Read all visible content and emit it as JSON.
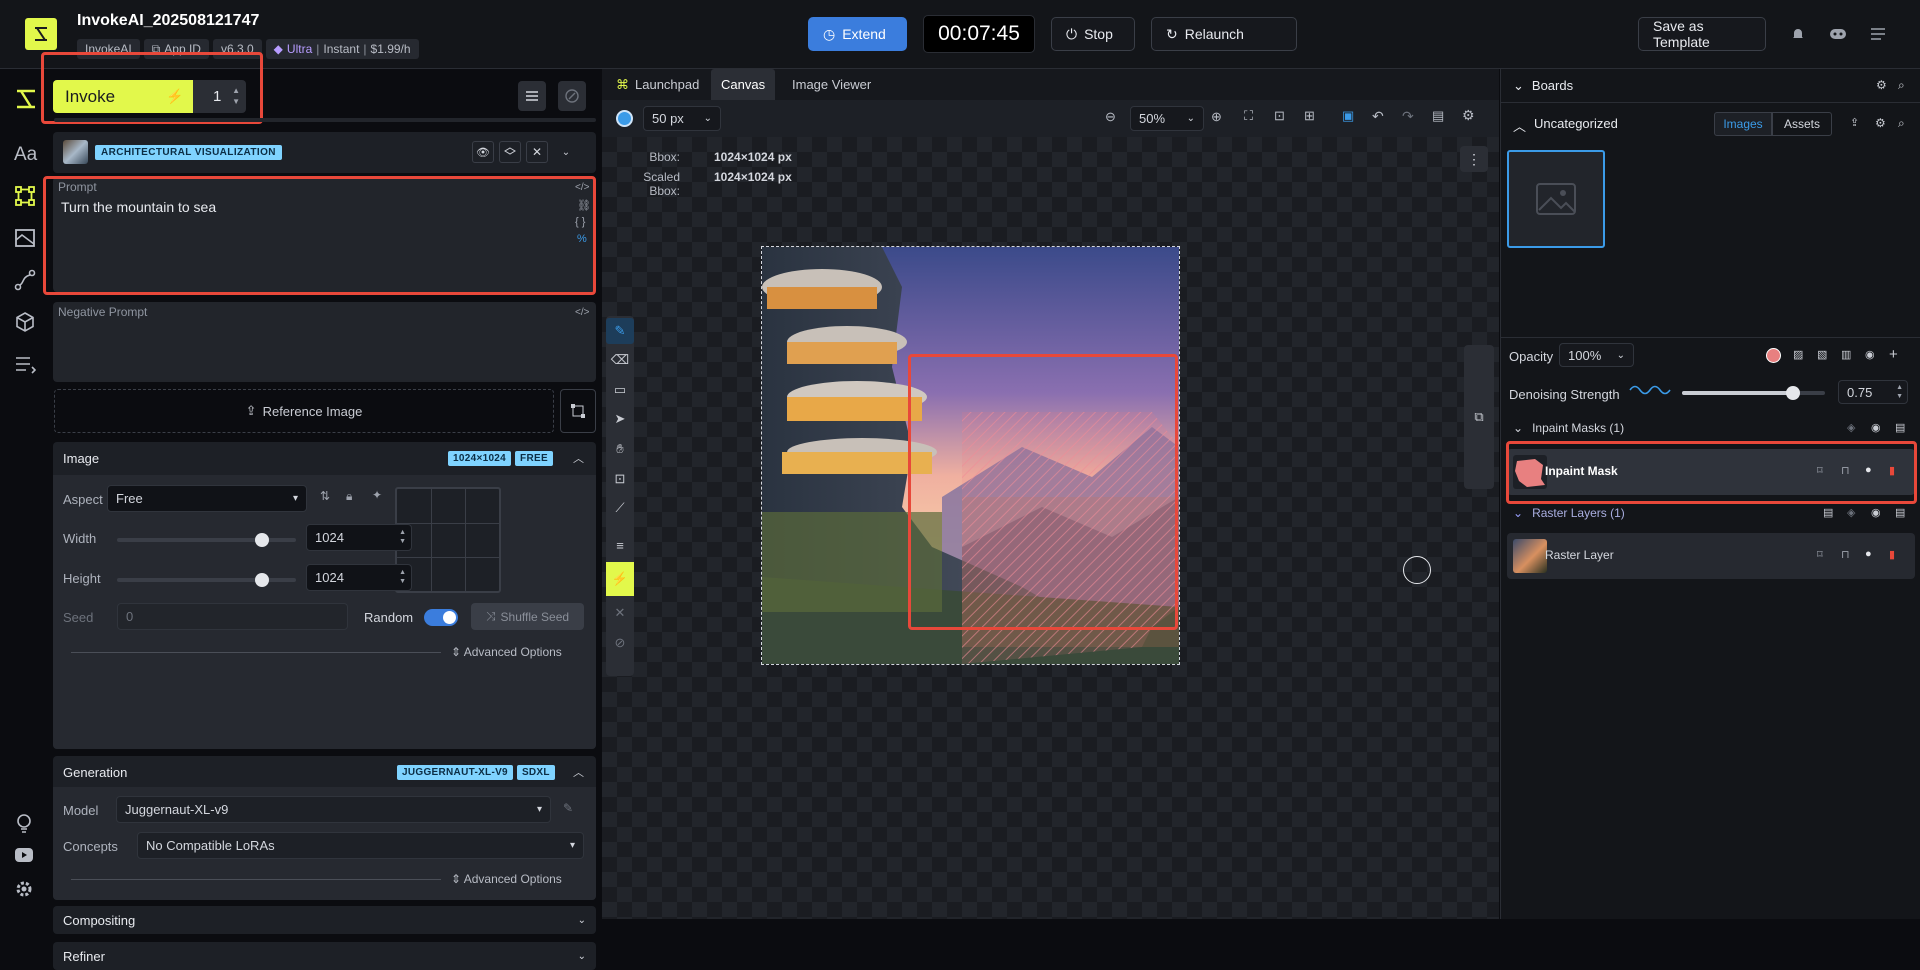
{
  "header": {
    "title": "InvokeAI_202508121747",
    "tags": {
      "brand": "InvokeAI",
      "app_id": "App ID",
      "version": "v6.3.0",
      "tier": "Ultra",
      "mode": "Instant",
      "price": "$1.99/h"
    },
    "extend": "Extend",
    "timer": "00:07:45",
    "stop": "Stop",
    "relaunch": "Relaunch",
    "save_template": "Save as Template"
  },
  "invoke": {
    "label": "Invoke",
    "count": "1"
  },
  "style_preset": {
    "label": "ARCHITECTURAL VISUALIZATION"
  },
  "prompt": {
    "label": "Prompt",
    "value": "Turn the mountain to sea"
  },
  "negative_prompt": {
    "label": "Negative Prompt",
    "value": ""
  },
  "reference_image": {
    "label": "Reference Image"
  },
  "image_section": {
    "title": "Image",
    "badge_size": "1024×1024",
    "badge_free": "FREE",
    "aspect_label": "Aspect",
    "aspect_value": "Free",
    "width_label": "Width",
    "width_value": "1024",
    "height_label": "Height",
    "height_value": "1024",
    "seed_label": "Seed",
    "seed_value": "0",
    "random_label": "Random",
    "random_on": true,
    "shuffle_label": "Shuffle Seed",
    "advanced": "Advanced Options"
  },
  "generation": {
    "title": "Generation",
    "badge_model": "JUGGERNAUT-XL-V9",
    "badge_arch": "SDXL",
    "model_label": "Model",
    "model_value": "Juggernaut-XL-v9",
    "concepts_label": "Concepts",
    "concepts_value": "No Compatible LoRAs",
    "advanced": "Advanced Options"
  },
  "compositing": {
    "title": "Compositing"
  },
  "refiner": {
    "title": "Refiner"
  },
  "tabs": [
    {
      "label": "Launchpad"
    },
    {
      "label": "Canvas",
      "active": true
    },
    {
      "label": "Image Viewer"
    }
  ],
  "canvas_toolbar": {
    "brush_size": "50 px",
    "zoom": "50%"
  },
  "bbox": {
    "bbox_label": "Bbox:",
    "bbox_value": "1024×1024 px",
    "scaled_label": "Scaled Bbox:",
    "scaled_value": "1024×1024 px"
  },
  "boards": {
    "title": "Boards",
    "board_name": "Uncategorized",
    "tab_images": "Images",
    "tab_assets": "Assets"
  },
  "layers": {
    "opacity_label": "Opacity",
    "opacity_value": "100%",
    "denoise_label": "Denoising Strength",
    "denoise_value": "0.75",
    "denoise_fraction": 0.75,
    "inpaint_group": "Inpaint Masks (1)",
    "inpaint_layer": "Inpaint Mask",
    "raster_group": "Raster Layers (1)",
    "raster_layer": "Raster Layer"
  },
  "colors": {
    "accent": "#e2f84b",
    "blue": "#3b7ddd",
    "highlight": "#e8483a",
    "mask": "#e88080"
  }
}
